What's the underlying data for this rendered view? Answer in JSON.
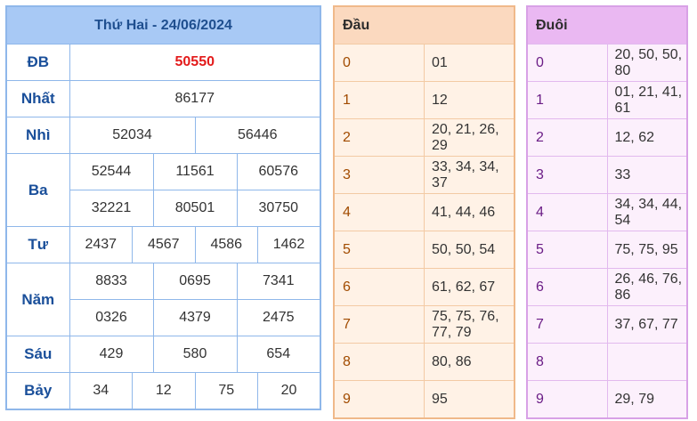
{
  "results": {
    "title": "Thứ Hai - 24/06/2024",
    "prizes": {
      "db": {
        "label": "ĐB",
        "values": [
          "50550"
        ]
      },
      "nhat": {
        "label": "Nhất",
        "values": [
          "86177"
        ]
      },
      "nhi": {
        "label": "Nhì",
        "values": [
          "52034",
          "56446"
        ]
      },
      "ba": {
        "label": "Ba",
        "values": [
          "52544",
          "11561",
          "60576",
          "32221",
          "80501",
          "30750"
        ]
      },
      "tu": {
        "label": "Tư",
        "values": [
          "2437",
          "4567",
          "4586",
          "1462"
        ]
      },
      "nam": {
        "label": "Năm",
        "values": [
          "8833",
          "0695",
          "7341",
          "0326",
          "4379",
          "2475"
        ]
      },
      "sau": {
        "label": "Sáu",
        "values": [
          "429",
          "580",
          "654"
        ]
      },
      "bay": {
        "label": "Bảy",
        "values": [
          "34",
          "12",
          "75",
          "20"
        ]
      }
    },
    "colors": {
      "special_prize": "#e31b1b",
      "border": "#8fb7ea",
      "header_bg": "#a8c9f5"
    }
  },
  "dau": {
    "header": "Đầu",
    "rows": [
      {
        "key": "0",
        "values": "01"
      },
      {
        "key": "1",
        "values": "12"
      },
      {
        "key": "2",
        "values": "20, 21, 26, 29"
      },
      {
        "key": "3",
        "values": "33, 34, 34, 37"
      },
      {
        "key": "4",
        "values": "41, 44, 46"
      },
      {
        "key": "5",
        "values": "50, 50, 54"
      },
      {
        "key": "6",
        "values": "61, 62, 67"
      },
      {
        "key": "7",
        "values": "75, 75, 76, 77, 79"
      },
      {
        "key": "8",
        "values": "80, 86"
      },
      {
        "key": "9",
        "values": "95"
      }
    ]
  },
  "duoi": {
    "header": "Đuôi",
    "rows": [
      {
        "key": "0",
        "values": "20, 50, 50, 80"
      },
      {
        "key": "1",
        "values": "01, 21, 41, 61"
      },
      {
        "key": "2",
        "values": "12, 62"
      },
      {
        "key": "3",
        "values": "33"
      },
      {
        "key": "4",
        "values": "34, 34, 44, 54"
      },
      {
        "key": "5",
        "values": "75, 75, 95"
      },
      {
        "key": "6",
        "values": "26, 46, 76, 86"
      },
      {
        "key": "7",
        "values": "37, 67, 77"
      },
      {
        "key": "8",
        "values": ""
      },
      {
        "key": "9",
        "values": "29, 79"
      }
    ]
  }
}
